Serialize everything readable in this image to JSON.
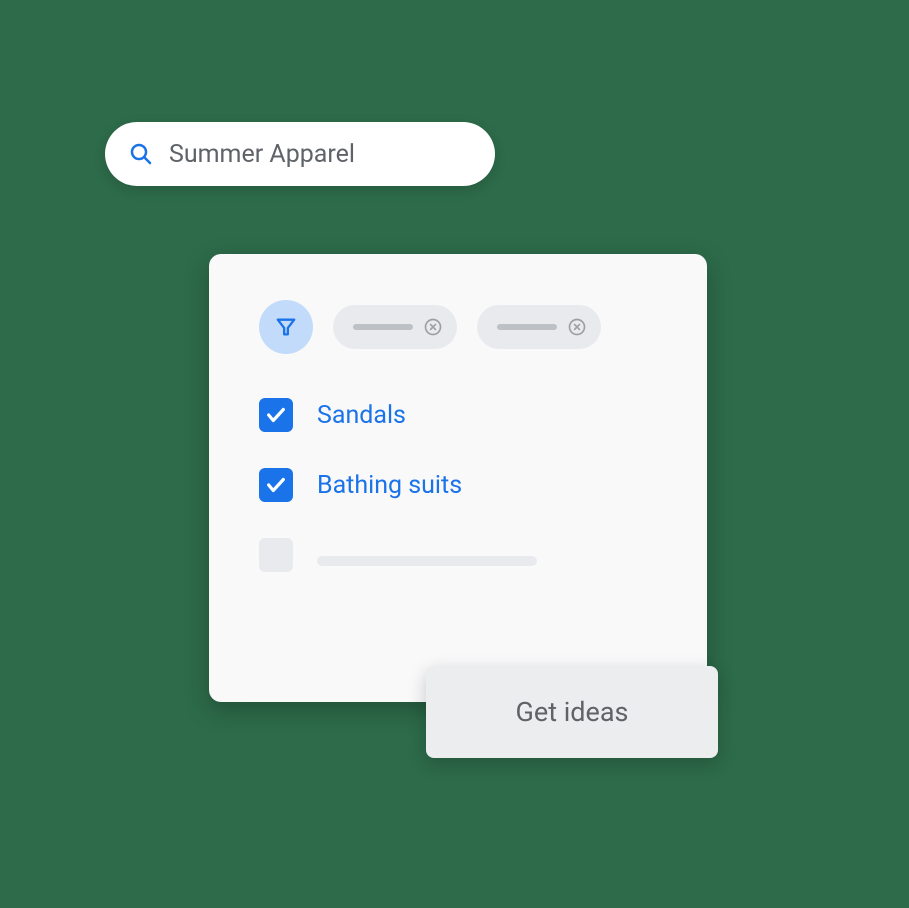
{
  "search": {
    "value": "Summer Apparel"
  },
  "options": [
    {
      "label": "Sandals",
      "checked": true
    },
    {
      "label": "Bathing suits",
      "checked": true
    }
  ],
  "button": {
    "label": "Get ideas"
  },
  "colors": {
    "blue": "#1a73e8",
    "greyText": "#5f6368",
    "background": "#2d6b4a"
  }
}
